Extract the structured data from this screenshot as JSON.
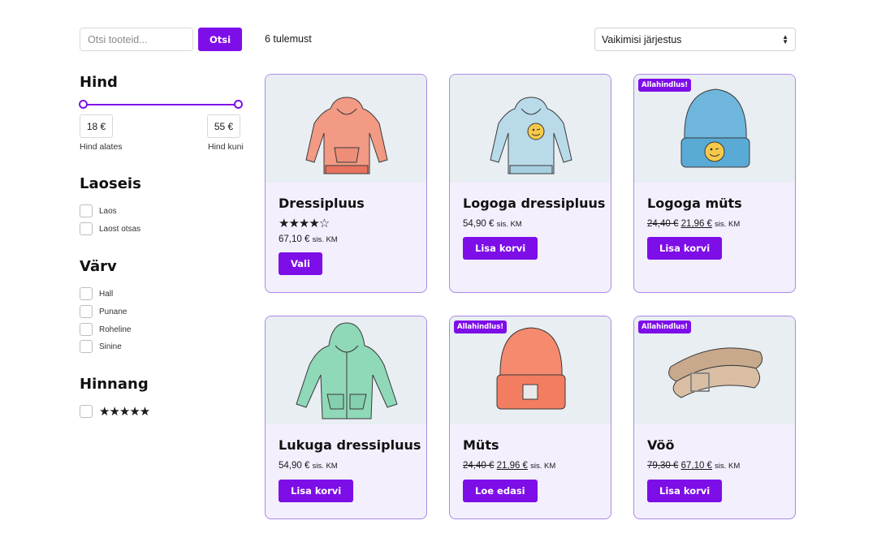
{
  "search": {
    "placeholder": "Otsi tooteid...",
    "button": "Otsi"
  },
  "results": {
    "count_label": "6 tulemust"
  },
  "sort": {
    "selected": "Vaikimisi järjestus"
  },
  "filters": {
    "price": {
      "title": "Hind",
      "min": "18 €",
      "max": "55 €",
      "min_label": "Hind alates",
      "max_label": "Hind kuni"
    },
    "stock": {
      "title": "Laoseis",
      "options": [
        "Laos",
        "Laost otsas"
      ]
    },
    "color": {
      "title": "Värv",
      "options": [
        "Hall",
        "Punane",
        "Roheline",
        "Sinine"
      ]
    },
    "rating": {
      "title": "Hinnang",
      "stars": "★★★★★"
    }
  },
  "products": [
    {
      "name": "Dressipluus",
      "rating": "★★★★☆",
      "price": "67,10 €",
      "tax": "sis. KM",
      "cta": "Vali",
      "image_icon": "hoodie-icon"
    },
    {
      "name": "Logoga dressipluus",
      "price": "54,90 €",
      "tax": "sis. KM",
      "cta": "Lisa korvi",
      "image_icon": "hoodie-logo-icon"
    },
    {
      "name": "Logoga müts",
      "badge": "Allahindlus!",
      "old_price": "24,40 €",
      "price": "21,96 €",
      "tax": "sis. KM",
      "cta": "Lisa korvi",
      "image_icon": "beanie-logo-icon"
    },
    {
      "name": "Lukuga dressipluus",
      "price": "54,90 €",
      "tax": "sis. KM",
      "cta": "Lisa korvi",
      "image_icon": "zip-hoodie-icon"
    },
    {
      "name": "Müts",
      "badge": "Allahindlus!",
      "old_price": "24,40 €",
      "price": "21,96 €",
      "tax": "sis. KM",
      "cta": "Loe edasi",
      "image_icon": "beanie-icon"
    },
    {
      "name": "Vöö",
      "badge": "Allahindlus!",
      "old_price": "79,30 €",
      "price": "67,10 €",
      "tax": "sis. KM",
      "cta": "Lisa korvi",
      "image_icon": "belt-icon"
    }
  ],
  "colors": {
    "accent": "#7e0ee8",
    "card_bg": "#f4effd",
    "card_border": "#a98ae8",
    "image_bg": "#e8eef2"
  }
}
